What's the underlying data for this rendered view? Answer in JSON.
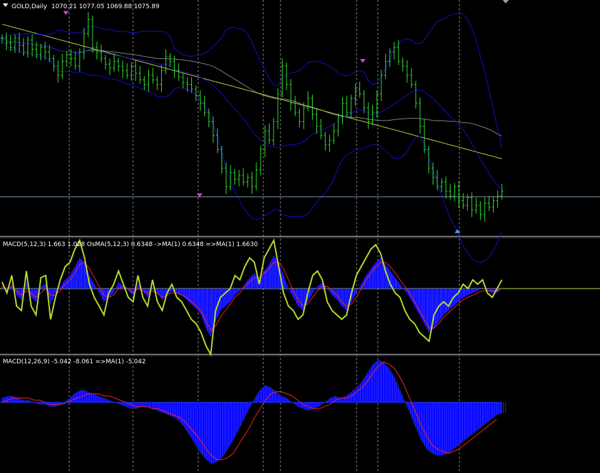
{
  "window": {
    "symbol_title": "GOLD,Daily",
    "ohlc": "1070.21 1077.05 1069.88 1075.89"
  },
  "panels": {
    "macd_fast_title": "MACD(5,12,3) 1.663 1.028  OsMA(5,12,3) 0.6348  ->MA(1) 0.6348  =>MA(1) 1.6630",
    "macd_slow_title": "MACD(12,26,9) -5.042 -8.061  =>MA(1) -5.042"
  },
  "colors": {
    "background": "#000000",
    "candle": "#33e033",
    "bollinger": "#1010c8",
    "ma_long": "#b8d040",
    "ma_mid": "#808080",
    "hline": "#7a9ab8",
    "histogram": "#0000ff",
    "signal": "#ff2020",
    "macd_line": "#b8dc30",
    "zero_line_fast": "#c0e040",
    "zero_line_slow": "#1a3cff",
    "arrow_down": "#d040d0",
    "arrow_up": "#40a0e0",
    "separator": "#e0e0e0"
  },
  "chart_data": [
    {
      "type": "line",
      "title": "GOLD,Daily",
      "series": [
        {
          "values": [
            1190,
            1185,
            1180,
            1190,
            1182,
            1175,
            1188,
            1178,
            1172,
            1180,
            1175,
            1168,
            1160,
            1150,
            1165,
            1172,
            1168,
            1160,
            1175,
            1195,
            1210,
            1180,
            1175,
            1168,
            1162,
            1158,
            1165,
            1160,
            1155,
            1150,
            1160,
            1152,
            1145,
            1140,
            1150,
            1145,
            1140,
            1155,
            1170,
            1165,
            1155,
            1148,
            1142,
            1140,
            1135,
            1128,
            1120,
            1110,
            1100,
            1085,
            1070,
            1050,
            1030,
            1045,
            1038,
            1042,
            1035,
            1040,
            1030,
            1048,
            1070,
            1090,
            1080,
            1100,
            1130,
            1160,
            1140,
            1120,
            1110,
            1100,
            1115,
            1125,
            1108,
            1095,
            1085,
            1075,
            1080,
            1090,
            1105,
            1120,
            1110,
            1125,
            1135,
            1130,
            1115,
            1100,
            1110,
            1130,
            1150,
            1165,
            1175,
            1180,
            1165,
            1160,
            1150,
            1140,
            1120,
            1095,
            1070,
            1050,
            1040,
            1030,
            1035,
            1025,
            1020,
            1030,
            1015,
            1010,
            1018,
            1005,
            1010,
            1000,
            1012,
            1008,
            1015,
            1020,
            1025
          ]
        }
      ],
      "ylim": [
        980,
        1220
      ]
    },
    {
      "type": "bar",
      "title": "MACD(5,12,3) 1.663 1.028  OsMA(5,12,3) 0.6348  ->MA(1) 0.6348  =>MA(1) 1.6630",
      "series": [
        {
          "values": [
            1,
            -1,
            2,
            -3,
            -5,
            3,
            -4,
            -6,
            1,
            2,
            -7,
            -2,
            1,
            4,
            6,
            10,
            14,
            12,
            6,
            2,
            -2,
            -6,
            -4,
            -2,
            3,
            1,
            -1,
            -3,
            2,
            -1,
            -4,
            0,
            -2,
            -5,
            -3,
            -1,
            -2,
            -3,
            -5,
            -7,
            -9,
            -12,
            -18,
            -22,
            -15,
            -10,
            -8,
            -6,
            -3,
            -1,
            2,
            5,
            7,
            4,
            8,
            11,
            15,
            12,
            6,
            0,
            -4,
            -8,
            -10,
            -6,
            -2,
            1,
            3,
            0,
            -3,
            -5,
            -8,
            -10,
            -6,
            -2,
            2,
            6,
            9,
            12,
            14,
            11,
            8,
            5,
            2,
            -1,
            -4,
            -8,
            -12,
            -16,
            -20,
            -18,
            -15,
            -12,
            -10,
            -8,
            -6,
            -4,
            -3,
            -2,
            -1,
            0,
            -1,
            -2,
            -2,
            0
          ]
        },
        {
          "values": [
            1,
            0,
            1,
            -1,
            -3,
            -1,
            -2,
            -4,
            -2,
            0,
            -3,
            -3,
            -1,
            2,
            4,
            7,
            11,
            12,
            9,
            5,
            1,
            -3,
            -4,
            -3,
            0,
            1,
            0,
            -2,
            0,
            -1,
            -2,
            -1,
            -2,
            -4,
            -3,
            -2,
            -2,
            -3,
            -4,
            -6,
            -8,
            -10,
            -15,
            -19,
            -17,
            -13,
            -10,
            -7,
            -4,
            -2,
            1,
            3,
            5,
            5,
            7,
            9,
            12,
            12,
            9,
            4,
            -1,
            -5,
            -8,
            -7,
            -4,
            -1,
            1,
            1,
            -1,
            -3,
            -6,
            -8,
            -7,
            -4,
            0,
            4,
            7,
            10,
            12,
            12,
            10,
            7,
            4,
            1,
            -2,
            -6,
            -10,
            -14,
            -18,
            -18,
            -16,
            -13,
            -11,
            -9,
            -7,
            -5,
            -4,
            -3,
            -2,
            -1,
            -1,
            -1,
            -1,
            0
          ]
        },
        {
          "values": [
            3,
            -2,
            6,
            -8,
            -10,
            8,
            -8,
            -12,
            5,
            6,
            -14,
            -4,
            4,
            10,
            12,
            18,
            22,
            14,
            2,
            -4,
            -8,
            -12,
            -2,
            2,
            8,
            2,
            -4,
            -6,
            6,
            -4,
            -8,
            4,
            -6,
            -10,
            -2,
            2,
            -4,
            -6,
            -10,
            -14,
            -16,
            -20,
            -26,
            -30,
            -10,
            -4,
            -2,
            0,
            6,
            4,
            10,
            14,
            12,
            2,
            14,
            18,
            22,
            10,
            -2,
            -8,
            -10,
            -14,
            -12,
            -2,
            6,
            8,
            4,
            -6,
            -10,
            -12,
            -14,
            -12,
            -2,
            6,
            10,
            14,
            18,
            20,
            16,
            8,
            2,
            -2,
            -4,
            -10,
            -14,
            -16,
            -20,
            -22,
            -24,
            -12,
            -8,
            -6,
            -8,
            -4,
            -2,
            2,
            0,
            4,
            2,
            4,
            -2,
            -4,
            0,
            4
          ]
        }
      ]
    },
    {
      "type": "bar",
      "title": "MACD(12,26,9) -5.042 -8.061  =>MA(1) -5.042",
      "series": [
        {
          "values": [
            2,
            3,
            3,
            2,
            1,
            1,
            0,
            -1,
            -1,
            -2,
            -2,
            -1,
            1,
            3,
            5,
            6,
            5,
            4,
            3,
            2,
            1,
            0,
            -1,
            -2,
            -3,
            -3,
            -2,
            -2,
            -3,
            -4,
            -5,
            -6,
            -7,
            -9,
            -12,
            -16,
            -20,
            -24,
            -27,
            -29,
            -28,
            -26,
            -22,
            -18,
            -13,
            -8,
            -3,
            2,
            6,
            8,
            7,
            5,
            3,
            2,
            0,
            -2,
            -3,
            -4,
            -3,
            -2,
            0,
            2,
            3,
            2,
            3,
            5,
            7,
            10,
            14,
            18,
            20,
            19,
            16,
            12,
            6,
            0,
            -6,
            -12,
            -18,
            -22,
            -24,
            -25,
            -25,
            -24,
            -22,
            -20,
            -18,
            -16,
            -14,
            -12,
            -10,
            -8,
            -6,
            -5
          ]
        },
        {
          "values": [
            0,
            1,
            2,
            2,
            2,
            2,
            1,
            1,
            0,
            -1,
            -1,
            -1,
            0,
            1,
            2,
            3,
            4,
            4,
            4,
            3,
            3,
            2,
            1,
            0,
            -1,
            -2,
            -2,
            -2,
            -3,
            -3,
            -4,
            -5,
            -6,
            -7,
            -9,
            -12,
            -15,
            -18,
            -22,
            -25,
            -27,
            -27,
            -26,
            -24,
            -20,
            -16,
            -12,
            -7,
            -3,
            1,
            4,
            5,
            5,
            4,
            3,
            1,
            -1,
            -2,
            -3,
            -3,
            -2,
            -1,
            1,
            2,
            2,
            3,
            5,
            7,
            10,
            14,
            17,
            19,
            18,
            16,
            12,
            7,
            1,
            -5,
            -11,
            -16,
            -20,
            -22,
            -23,
            -24,
            -23,
            -22,
            -20,
            -18,
            -16,
            -14,
            -12,
            -10,
            -8
          ]
        }
      ]
    }
  ]
}
